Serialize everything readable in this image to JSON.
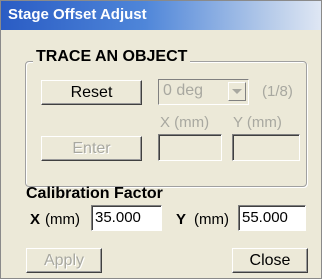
{
  "window": {
    "title": "Stage Offset Adjust"
  },
  "trace": {
    "group_title": "TRACE AN OBJECT",
    "reset_label": "Reset",
    "angle_value": "0 deg",
    "step_label": "(1/8)",
    "x_label": "X (mm)",
    "y_label": "Y (mm)",
    "enter_label": "Enter",
    "x_value": "",
    "y_value": ""
  },
  "calibration": {
    "title": "Calibration Factor",
    "x_label_bold": "X",
    "x_label_unit": "(mm)",
    "x_value": "35.000",
    "y_label_bold": "Y",
    "y_label_unit": "(mm)",
    "y_value": "55.000"
  },
  "footer": {
    "apply_label": "Apply",
    "close_label": "Close"
  },
  "colors": {
    "title_bar_start": "#2a5cc4",
    "title_bar_end": "#dfe7f4",
    "disabled_text": "#a8a8a0",
    "window_bg": "#ece9d8"
  }
}
